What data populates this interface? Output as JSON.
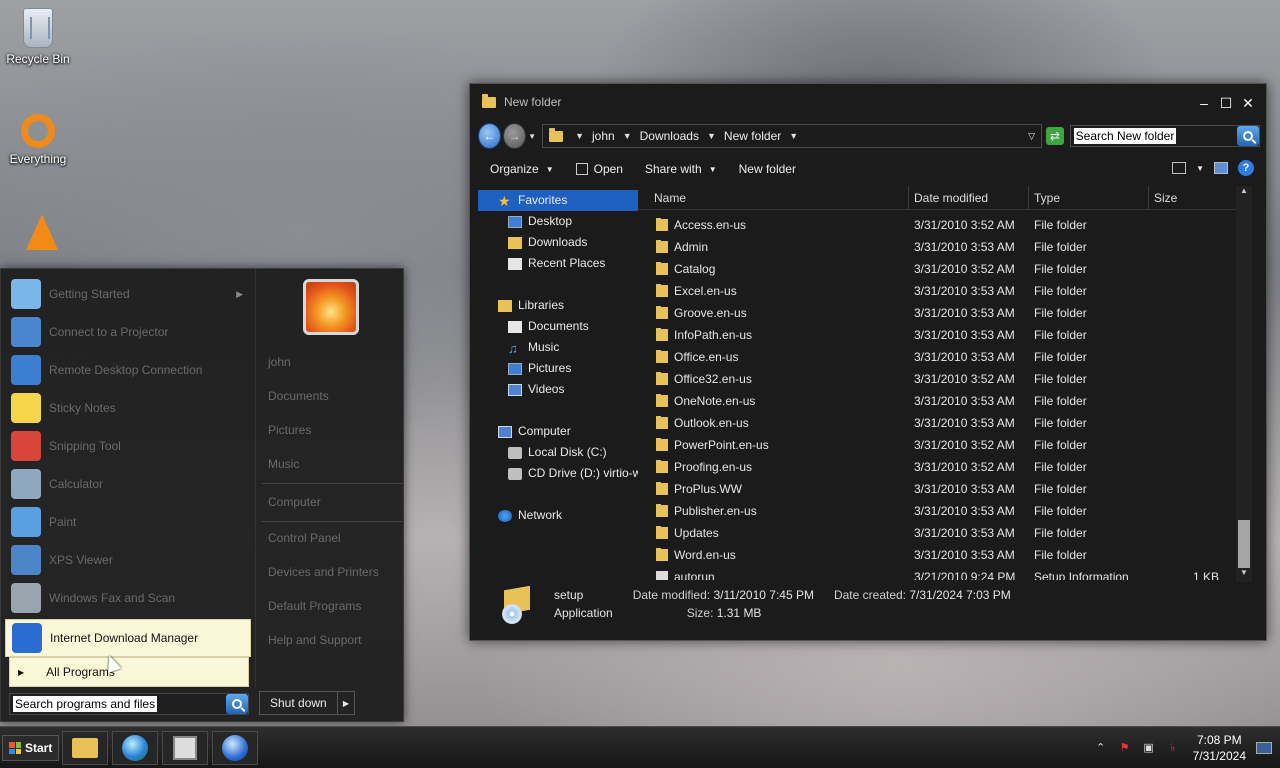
{
  "desktop": {
    "icons": [
      {
        "label": "Recycle Bin",
        "icon": "recycle-bin-icon"
      },
      {
        "label": "Everything",
        "icon": "everything-icon"
      },
      {
        "label": "",
        "icon": "vlc-icon"
      }
    ]
  },
  "explorer": {
    "title": "New folder",
    "breadcrumb": [
      "john",
      "Downloads",
      "New folder"
    ],
    "search_placeholder": "Search New folder",
    "toolbar": {
      "organize": "Organize",
      "open": "Open",
      "share_with": "Share with",
      "new_folder": "New folder"
    },
    "nav": {
      "favorites": "Favorites",
      "favorites_items": [
        "Desktop",
        "Downloads",
        "Recent Places"
      ],
      "libraries": "Libraries",
      "libraries_items": [
        "Documents",
        "Music",
        "Pictures",
        "Videos"
      ],
      "computer": "Computer",
      "computer_items": [
        "Local Disk (C:)",
        "CD Drive (D:) virtio-w"
      ],
      "network": "Network"
    },
    "columns": {
      "name": "Name",
      "date": "Date modified",
      "type": "Type",
      "size": "Size"
    },
    "files": [
      {
        "name": "Access.en-us",
        "date": "3/31/2010 3:52 AM",
        "type": "File folder",
        "size": ""
      },
      {
        "name": "Admin",
        "date": "3/31/2010 3:53 AM",
        "type": "File folder",
        "size": ""
      },
      {
        "name": "Catalog",
        "date": "3/31/2010 3:52 AM",
        "type": "File folder",
        "size": ""
      },
      {
        "name": "Excel.en-us",
        "date": "3/31/2010 3:53 AM",
        "type": "File folder",
        "size": ""
      },
      {
        "name": "Groove.en-us",
        "date": "3/31/2010 3:53 AM",
        "type": "File folder",
        "size": ""
      },
      {
        "name": "InfoPath.en-us",
        "date": "3/31/2010 3:53 AM",
        "type": "File folder",
        "size": ""
      },
      {
        "name": "Office.en-us",
        "date": "3/31/2010 3:53 AM",
        "type": "File folder",
        "size": ""
      },
      {
        "name": "Office32.en-us",
        "date": "3/31/2010 3:52 AM",
        "type": "File folder",
        "size": ""
      },
      {
        "name": "OneNote.en-us",
        "date": "3/31/2010 3:53 AM",
        "type": "File folder",
        "size": ""
      },
      {
        "name": "Outlook.en-us",
        "date": "3/31/2010 3:53 AM",
        "type": "File folder",
        "size": ""
      },
      {
        "name": "PowerPoint.en-us",
        "date": "3/31/2010 3:52 AM",
        "type": "File folder",
        "size": ""
      },
      {
        "name": "Proofing.en-us",
        "date": "3/31/2010 3:52 AM",
        "type": "File folder",
        "size": ""
      },
      {
        "name": "ProPlus.WW",
        "date": "3/31/2010 3:53 AM",
        "type": "File folder",
        "size": ""
      },
      {
        "name": "Publisher.en-us",
        "date": "3/31/2010 3:53 AM",
        "type": "File folder",
        "size": ""
      },
      {
        "name": "Updates",
        "date": "3/31/2010 3:53 AM",
        "type": "File folder",
        "size": ""
      },
      {
        "name": "Word.en-us",
        "date": "3/31/2010 3:53 AM",
        "type": "File folder",
        "size": ""
      },
      {
        "name": "autorun",
        "date": "3/21/2010 9:24 PM",
        "type": "Setup Information",
        "size": "1 KB"
      }
    ],
    "details": {
      "name": "setup",
      "kind": "Application",
      "modified_label": "Date modified:",
      "modified_value": "3/11/2010 7:45 PM",
      "size_label": "Size:",
      "size_value": "1.31 MB",
      "created_label": "Date created:",
      "created_value": "7/31/2024 7:03 PM"
    }
  },
  "start_menu": {
    "programs": [
      {
        "label": "Getting Started",
        "icon": "getting-started-icon",
        "submenu": true
      },
      {
        "label": "Connect to a Projector",
        "icon": "projector-icon"
      },
      {
        "label": "Remote Desktop Connection",
        "icon": "remote-desktop-icon"
      },
      {
        "label": "Sticky Notes",
        "icon": "sticky-notes-icon"
      },
      {
        "label": "Snipping Tool",
        "icon": "snipping-tool-icon"
      },
      {
        "label": "Calculator",
        "icon": "calculator-icon"
      },
      {
        "label": "Paint",
        "icon": "paint-icon"
      },
      {
        "label": "XPS Viewer",
        "icon": "xps-viewer-icon"
      },
      {
        "label": "Windows Fax and Scan",
        "icon": "fax-scan-icon"
      },
      {
        "label": "Internet Download Manager",
        "icon": "idm-icon"
      }
    ],
    "all_programs": "All Programs",
    "search_placeholder": "Search programs and files",
    "places": {
      "user": "john",
      "documents": "Documents",
      "pictures": "Pictures",
      "music": "Music",
      "computer": "Computer",
      "control_panel": "Control Panel",
      "devices": "Devices and Printers",
      "default_programs": "Default Programs",
      "help": "Help and Support"
    },
    "shutdown": "Shut down"
  },
  "taskbar": {
    "start": "Start",
    "apps": [
      "explorer-icon",
      "browser-icon",
      "package-icon",
      "idm-icon"
    ],
    "clock_time": "7:08 PM",
    "clock_date": "7/31/2024"
  },
  "colors": {
    "selection": "#1f5fbf",
    "folder": "#e8c157",
    "highlight": "#fbf8d9"
  }
}
